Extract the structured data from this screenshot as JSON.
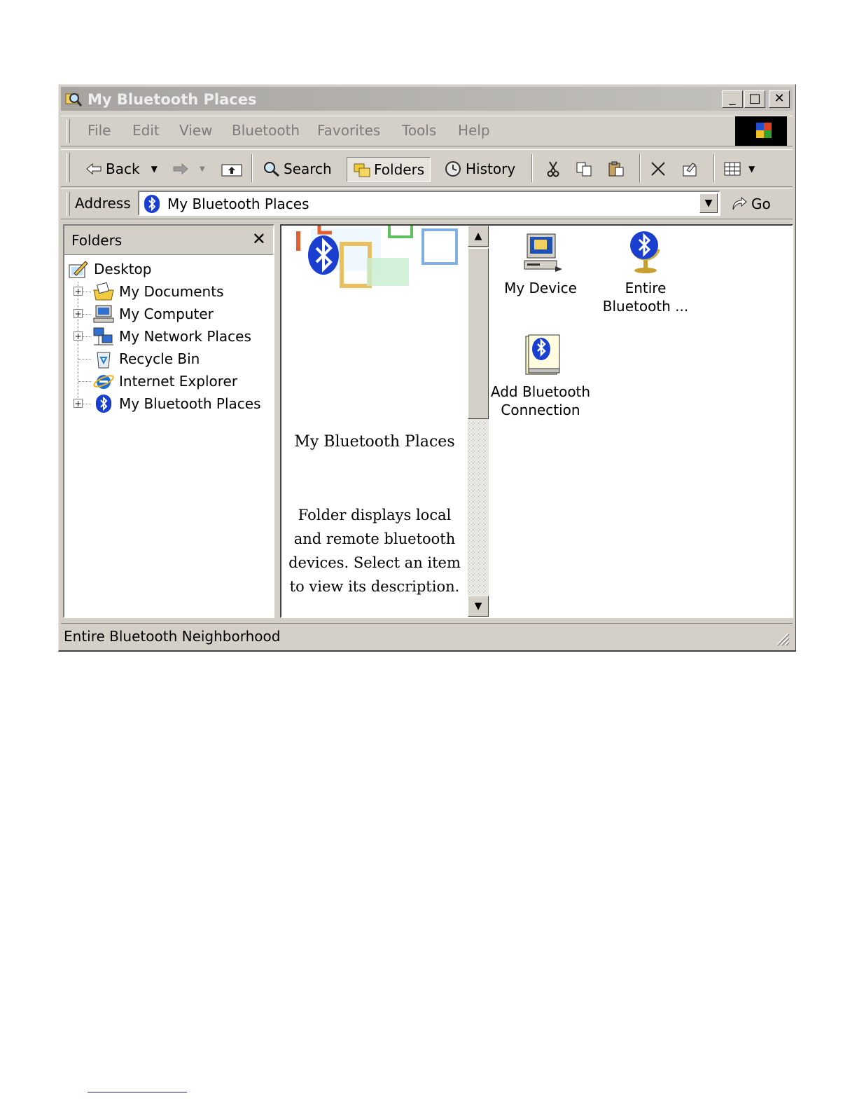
{
  "window": {
    "title": "My Bluetooth Places"
  },
  "title_buttons": {
    "minimize": "_",
    "maximize": "□",
    "close": "✕"
  },
  "menu": [
    "File",
    "Edit",
    "View",
    "Bluetooth",
    "Favorites",
    "Tools",
    "Help"
  ],
  "toolbar": {
    "back": "Back",
    "search": "Search",
    "folders": "Folders",
    "history": "History"
  },
  "address": {
    "label": "Address",
    "value": "My Bluetooth Places",
    "go": "Go"
  },
  "folders_pane": {
    "title": "Folders",
    "close": "✕",
    "tree": [
      {
        "label": "Desktop",
        "icon": "desktop-icon"
      },
      {
        "label": "My Documents",
        "icon": "my-documents-icon",
        "expandable": true
      },
      {
        "label": "My Computer",
        "icon": "my-computer-icon",
        "expandable": true
      },
      {
        "label": "My Network Places",
        "icon": "network-places-icon",
        "expandable": true
      },
      {
        "label": "Recycle Bin",
        "icon": "recycle-bin-icon"
      },
      {
        "label": "Internet Explorer",
        "icon": "internet-explorer-icon"
      },
      {
        "label": "My Bluetooth Places",
        "icon": "bluetooth-icon",
        "expandable": true
      }
    ]
  },
  "info_pane": {
    "title": "My Bluetooth Places",
    "description": "Folder displays local and remote bluetooth devices. Select an item to view its description."
  },
  "items": [
    {
      "label_1": "My Device",
      "label_2": "",
      "icon": "my-device-icon"
    },
    {
      "label_1": "Entire",
      "label_2": "Bluetooth ...",
      "icon": "bluetooth-globe-icon"
    },
    {
      "label_1": "Add Bluetooth",
      "label_2": "Connection",
      "icon": "add-connection-icon"
    }
  ],
  "status": {
    "text": "Entire Bluetooth Neighborhood"
  },
  "colors": {
    "bluetooth_blue": "#1a3fd0",
    "window_face": "#d4d0c8"
  }
}
